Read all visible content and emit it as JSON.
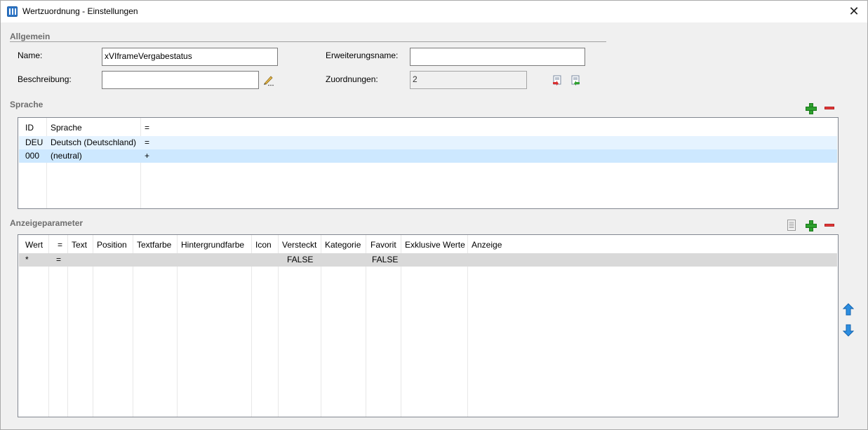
{
  "window": {
    "title": "Wertzuordnung - Einstellungen",
    "close_glyph": "✕"
  },
  "general": {
    "heading": "Allgemein",
    "name_label": "Name:",
    "name_value": "xVIframeVergabestatus",
    "description_label": "Beschreibung:",
    "description_value": "",
    "extension_label": "Erweiterungsname:",
    "extension_value": "",
    "mappings_label": "Zuordnungen:",
    "mappings_value": "2"
  },
  "language": {
    "heading": "Sprache",
    "columns": [
      "ID",
      "Sprache",
      "="
    ],
    "rows": [
      [
        "DEU",
        "Deutsch (Deutschland)",
        "="
      ],
      [
        "000",
        "(neutral)",
        "+"
      ]
    ]
  },
  "display": {
    "heading": "Anzeigeparameter",
    "columns": [
      "Wert",
      "=",
      "Text",
      "Position",
      "Textfarbe",
      "Hintergrundfarbe",
      "Icon",
      "Versteckt",
      "Kategorie",
      "Favorit",
      "Exklusive Werte",
      "Anzeige"
    ],
    "rows": [
      [
        "*",
        "=",
        "",
        "",
        "",
        "",
        "",
        "FALSE",
        "",
        "FALSE",
        "",
        ""
      ]
    ]
  },
  "colors": {
    "selected_row": "#cde8ff",
    "light_row": "#e5f3ff",
    "gray_row": "#d9d9d9",
    "accent_green": "#2ea02e",
    "accent_red": "#e23b3b",
    "arrow_blue": "#2b8de0"
  }
}
